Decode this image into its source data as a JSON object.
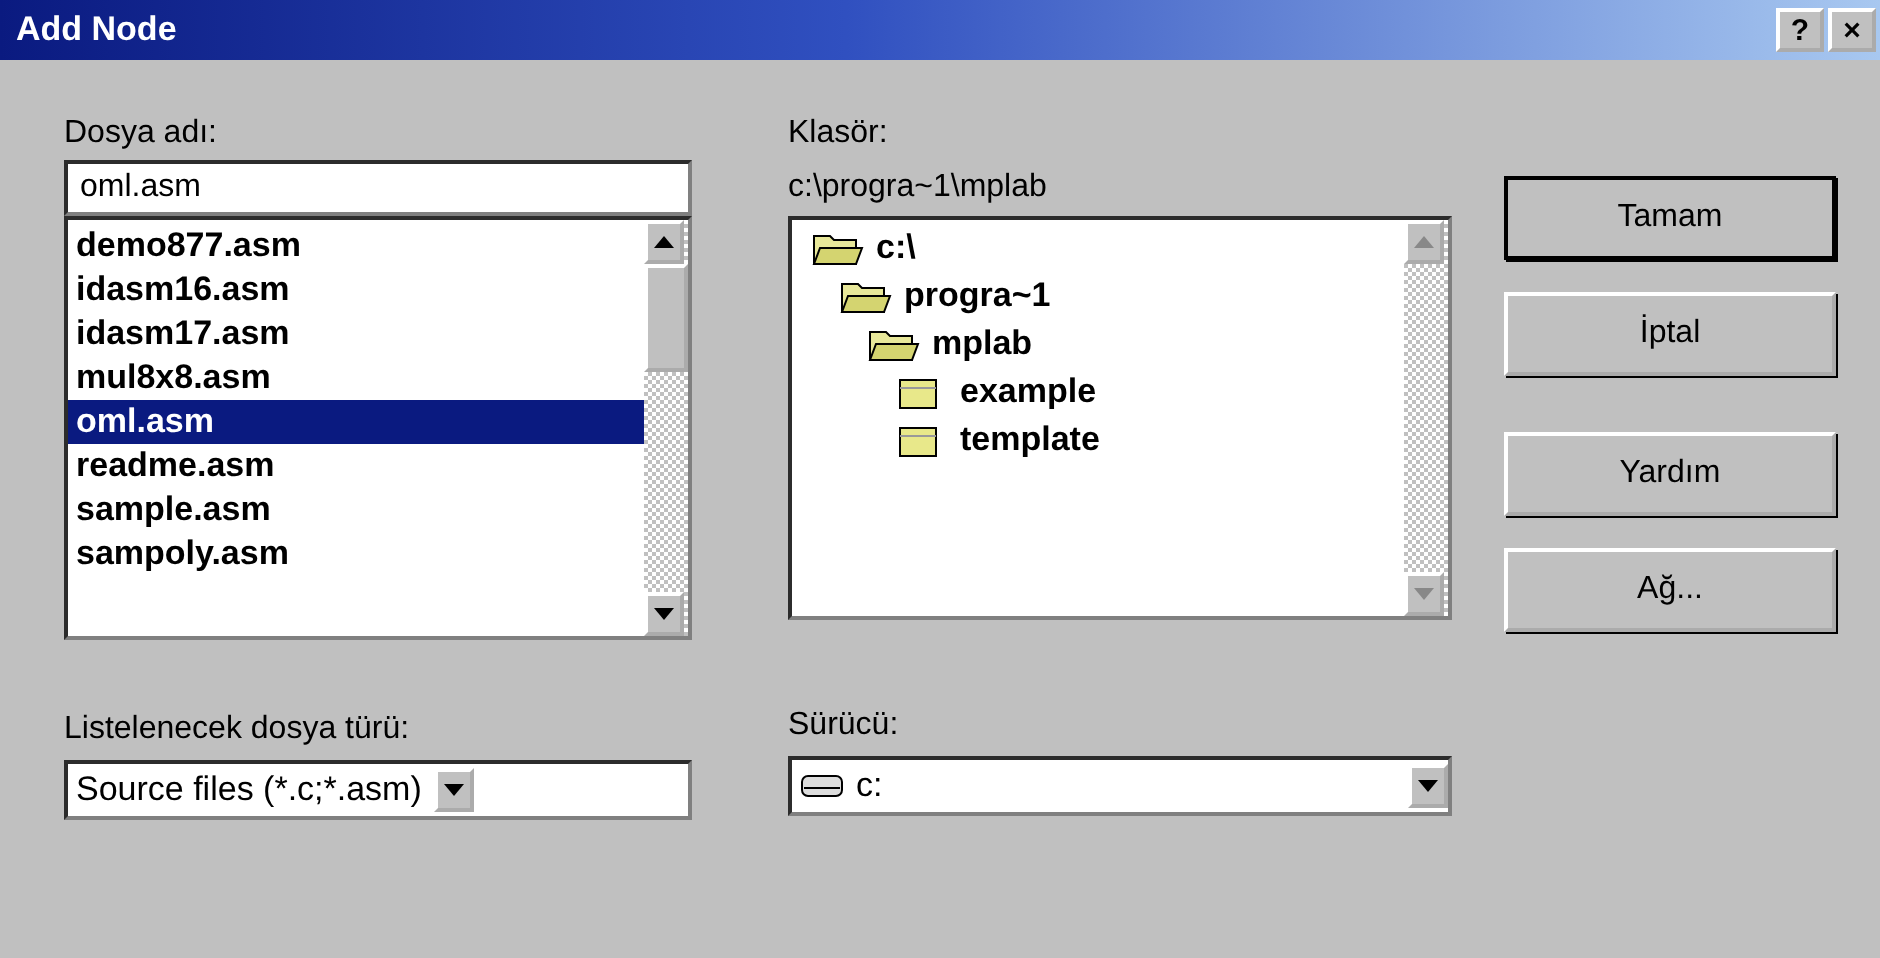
{
  "window": {
    "title": "Add Node",
    "title_buttons": [
      "?",
      "×"
    ]
  },
  "file_name": {
    "label": "Dosya adı:",
    "value": "oml.asm"
  },
  "files": [
    {
      "name": "demo877.asm",
      "selected": false
    },
    {
      "name": "idasm16.asm",
      "selected": false
    },
    {
      "name": "idasm17.asm",
      "selected": false
    },
    {
      "name": "mul8x8.asm",
      "selected": false
    },
    {
      "name": "oml.asm",
      "selected": true
    },
    {
      "name": "readme.asm",
      "selected": false
    },
    {
      "name": "sample.asm",
      "selected": false
    },
    {
      "name": "sampoly.asm",
      "selected": false
    }
  ],
  "folder": {
    "label": "Klasör:",
    "path": "c:\\progra~1\\mplab"
  },
  "tree": [
    {
      "name": "c:\\",
      "expanded": true,
      "children": [
        {
          "name": "progra~1",
          "expanded": true,
          "children": [
            {
              "name": "mplab",
              "expanded": true,
              "children": [
                {
                  "name": "example",
                  "expanded": false
                },
                {
                  "name": "template",
                  "expanded": false
                }
              ]
            }
          ]
        }
      ]
    }
  ],
  "file_type": {
    "label": "Listelenecek dosya türü:",
    "value": "Source files (*.c;*.asm)"
  },
  "drive": {
    "label": "Sürücü:",
    "value": "c:"
  },
  "buttons": [
    "Tamam",
    "İptal",
    "Yardım",
    "Ağ..."
  ]
}
